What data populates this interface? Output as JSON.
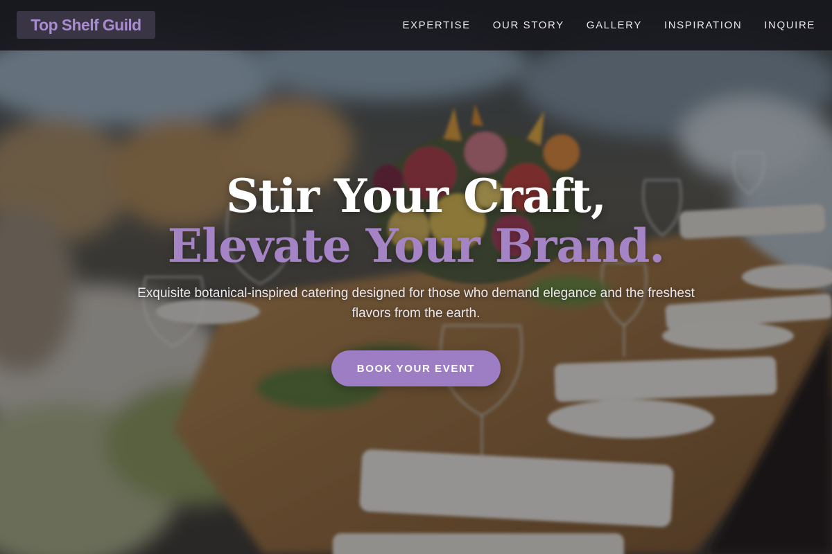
{
  "header": {
    "logo_text": "Top Shelf Guild",
    "nav": [
      {
        "label": "EXPERTISE"
      },
      {
        "label": "OUR STORY"
      },
      {
        "label": "GALLERY"
      },
      {
        "label": "INSPIRATION"
      },
      {
        "label": "INQUIRE"
      }
    ]
  },
  "hero": {
    "headline_line1": "Stir Your Craft,",
    "headline_line2": "Elevate Your Brand.",
    "subtitle": "Exquisite botanical-inspired catering designed for those who demand elegance and the freshest flavors from the earth.",
    "cta_label": "BOOK YOUR EVENT"
  },
  "colors": {
    "accent": "#9d7dc4",
    "headline_accent": "#a584c6",
    "navbar_bg": "#18181e"
  },
  "icons": {
    "background": "banquet-table-photo"
  }
}
